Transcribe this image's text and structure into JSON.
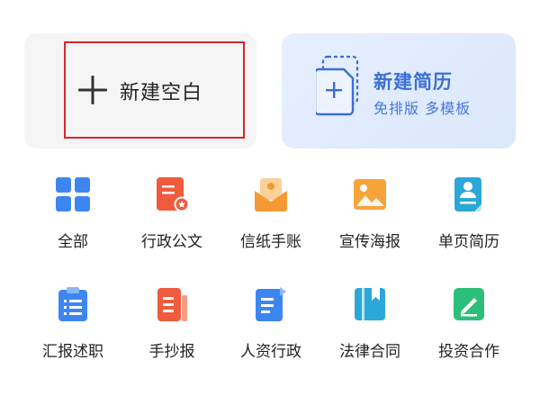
{
  "create_cards": {
    "blank": {
      "label": "新建空白",
      "icon": "plus-icon"
    },
    "resume": {
      "title": "新建简历",
      "subtitle": "免排版 多模板",
      "icon": "resume-document-icon"
    }
  },
  "categories": [
    {
      "label": "全部",
      "icon": "grid-all-icon",
      "color": "#3d86f0"
    },
    {
      "label": "行政公文",
      "icon": "official-document-icon",
      "color": "#ef5b3c"
    },
    {
      "label": "信纸手账",
      "icon": "letter-envelope-icon",
      "color": "#f39a35"
    },
    {
      "label": "宣传海报",
      "icon": "poster-image-icon",
      "color": "#f6a33a"
    },
    {
      "label": "单页简历",
      "icon": "resume-person-icon",
      "color": "#2ba8d7"
    },
    {
      "label": "汇报述职",
      "icon": "clipboard-report-icon",
      "color": "#3d86f0"
    },
    {
      "label": "手抄报",
      "icon": "handwritten-paper-icon",
      "color": "#ef5b3c"
    },
    {
      "label": "人资行政",
      "icon": "hr-document-icon",
      "color": "#3d86f0"
    },
    {
      "label": "法律合同",
      "icon": "law-book-icon",
      "color": "#2ba8d7"
    },
    {
      "label": "投资合作",
      "icon": "investment-edit-icon",
      "color": "#2cbf7a"
    }
  ]
}
